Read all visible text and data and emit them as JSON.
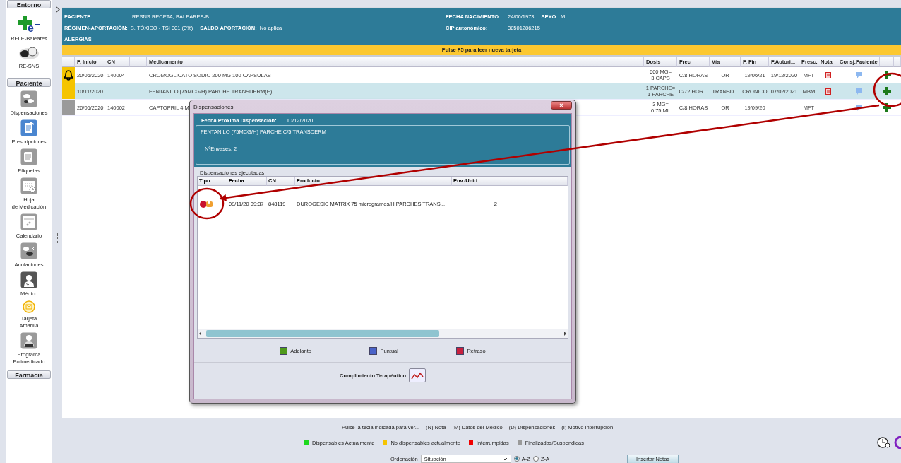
{
  "sidebar": {
    "sections": [
      {
        "title": "Entorno",
        "items": [
          {
            "label": "RELE-Baleares",
            "logo": "e"
          },
          {
            "label": "RE-SNS"
          }
        ]
      },
      {
        "title": "Paciente",
        "items": [
          {
            "label": "Dispensaciones"
          },
          {
            "label": "Prescripciones"
          },
          {
            "label": "Etiquetas"
          },
          {
            "label": "Hoja\nde Medicación"
          },
          {
            "label": "Calendario"
          },
          {
            "label": "Anulaciones"
          },
          {
            "label": "Médico"
          },
          {
            "label": "Tarjeta\nAmarilla"
          },
          {
            "label": "Programa\nPolimedicado"
          }
        ]
      },
      {
        "title": "Farmacia"
      }
    ]
  },
  "patient": {
    "lines": [
      {
        "left": [
          {
            "label": "PACIENTE:",
            "value": "RESNS RECETA, BALEARES-B"
          }
        ],
        "right": [
          {
            "label": "FECHA NACIMIENTO:",
            "value": "24/06/1973"
          },
          {
            "label": "SEXO:",
            "value": "M"
          }
        ]
      },
      {
        "left": [
          {
            "label": "RÉGIMEN-APORTACIÓN:",
            "value": "S. TÓXICO - TSI 001 (0%)"
          },
          {
            "label": "SALDO APORTACIÓN:",
            "value": "No aplica"
          }
        ],
        "right": [
          {
            "label": "CIP autonómico:",
            "value": "38501286215"
          }
        ]
      },
      {
        "left": [
          {
            "label": "ALERGIAS"
          }
        ]
      }
    ]
  },
  "notice": "Pulse F5 para leer nueva tarjeta",
  "table": {
    "columns": [
      "F. Inicio",
      "CN",
      "",
      "Medicamento",
      "Dosis",
      "Frec",
      "Vía",
      "F. Fin",
      "F.Autori...",
      "Presc.",
      "Nota",
      "Consj.Paciente"
    ],
    "rows": [
      {
        "color": "#f5c400",
        "alert": true,
        "selected": false,
        "note": true,
        "cells": [
          "20/06/2020",
          "140004",
          "",
          "CROMOGLICATO SODIO 200 MG 100 CAPSULAS",
          "600 MG=\n3 CAPS",
          "C/8 HORAS",
          "OR",
          "19/06/21",
          "19/12/2020",
          "MFT"
        ]
      },
      {
        "color": "#f5c400",
        "alert": false,
        "selected": true,
        "note": true,
        "cells": [
          "10/11/2020",
          "",
          "",
          "FENTANILO (75MCG/H) PARCHE TRANSDERM(E)",
          "1 PARCHE=\n1 PARCHE",
          "C/72 HOR...",
          "TRANSD...",
          "CRONICO",
          "07/02/2021",
          "MBM"
        ]
      },
      {
        "color": "#9a9a9a",
        "alert": false,
        "selected": false,
        "note": false,
        "cells": [
          "20/06/2020",
          "140002",
          "",
          "CAPTOPRIL 4 M",
          "3 MG=\n0.75 ML",
          "C/8 HORAS",
          "OR",
          "19/09/20",
          "",
          "MFT"
        ]
      }
    ]
  },
  "dialog": {
    "title": "Dispensaciones",
    "close": "×",
    "next_label": "Fecha Próxima Dispensación:",
    "next_value": "10/12/2020",
    "product": "FENTANILO (75MCG/H) PARCHE C/5 TRANSDERM",
    "packages": "NºEnvases: 2",
    "section": "Dispensaciones ejecutadas",
    "columns": [
      "Tipo",
      "Fecha",
      "CN",
      "Producto",
      "Env./Unid."
    ],
    "rows": [
      {
        "cells": [
          "",
          "09/11/20 09:37",
          "848119",
          "DUROGESIC MATRIX 75 microgramos/H PARCHES TRANS...",
          "2"
        ]
      }
    ],
    "legend": [
      {
        "label": "Adelanto",
        "color": "#4f9a1c"
      },
      {
        "label": "Puntual",
        "color": "#4a63c8"
      },
      {
        "label": "Retraso",
        "color": "#c8203e"
      }
    ],
    "compliance": "Cumplimiento Terapéutico"
  },
  "footer": {
    "hint": "Pulse la tecla indicada para ver...",
    "keys": [
      "(N) Nota",
      "(M) Datos del Médico",
      "(D) Dispensaciones",
      "(I) Motivo Interrupción"
    ],
    "legend": [
      {
        "label": "Dispensables Actualmente",
        "color": "#1ed81e"
      },
      {
        "label": "No dispensables actualmente",
        "color": "#f5c400"
      },
      {
        "label": "Interrumpidas",
        "color": "#f00000"
      },
      {
        "label": "Finalizadas/Suspendidas",
        "color": "#9a9a9a"
      }
    ],
    "sort_label": "Ordenación",
    "sort_value": "Situación",
    "order": [
      {
        "label": "A-Z",
        "selected": true
      },
      {
        "label": "Z-A",
        "selected": false
      }
    ],
    "button": "Insertar Notas"
  }
}
